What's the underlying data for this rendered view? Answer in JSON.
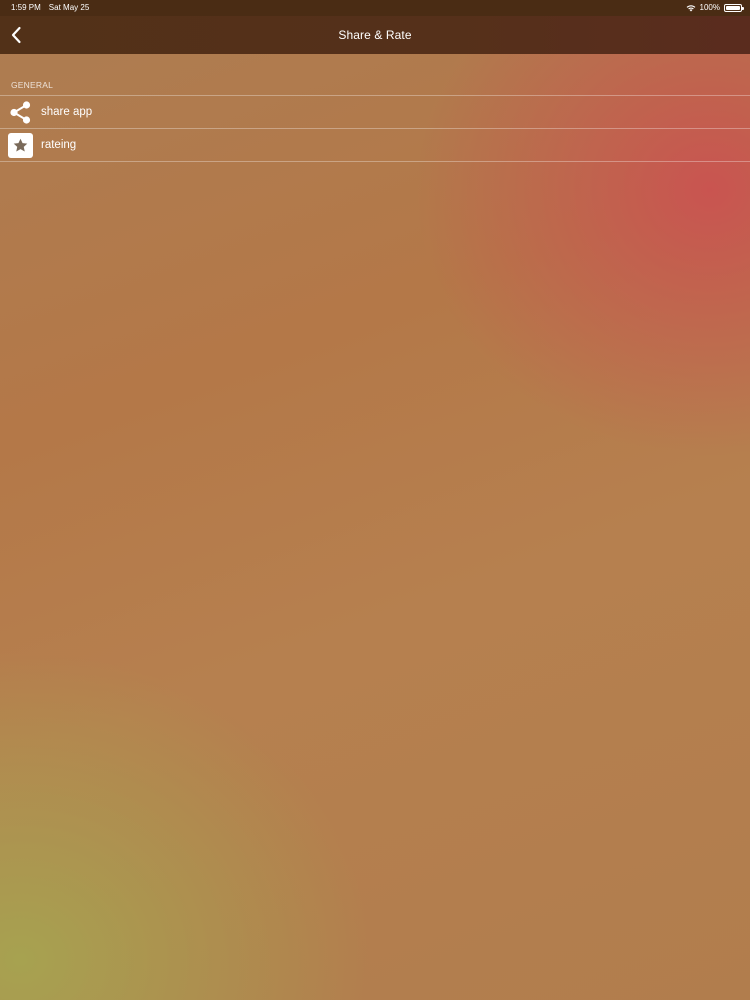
{
  "status_bar": {
    "time": "1:59 PM",
    "date": "Sat May 25",
    "battery": "100%",
    "battery_level": 1.0,
    "wifi_icon": "wifi-icon",
    "battery_icon": "battery-icon"
  },
  "nav": {
    "title": "Share & Rate",
    "back_icon": "chevron-left-icon"
  },
  "section": {
    "header": "GENERAL",
    "items": [
      {
        "icon": "share-icon",
        "label": "share app"
      },
      {
        "icon": "star-icon",
        "label": "rateing"
      }
    ]
  },
  "colors": {
    "bar_background": "#4a2c14",
    "nav_background": "#543019",
    "accent_red": "#cd4e52",
    "accent_olive": "#a6a450",
    "base_tan": "#b47848",
    "text": "#ffffff"
  }
}
